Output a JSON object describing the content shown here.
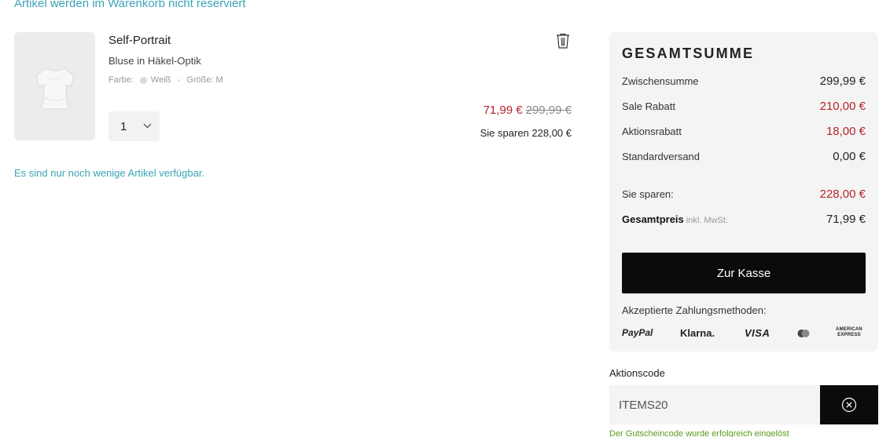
{
  "notice_top": "Artikel werden im Warenkorb nicht reserviert",
  "product": {
    "brand": "Self-Portrait",
    "name": "Bluse in Häkel-Optik",
    "color_label": "Farbe:",
    "color_value": "Weiß",
    "size_label": "Größe: M",
    "quantity": "1",
    "price_now": "71,99 €",
    "price_old": "299,99 €",
    "savings": "Sie sparen 228,00 €",
    "icons": {
      "delete": "trash-icon",
      "quantity": "chevron-down-icon"
    }
  },
  "low_stock": "Es sind nur noch wenige Artikel verfügbar.",
  "summary": {
    "title": "GESAMTSUMME",
    "rows": [
      {
        "label": "Zwischensumme",
        "value": "299,99 €"
      },
      {
        "label": "Sale Rabatt",
        "value": "210,00 €"
      },
      {
        "label": "Aktionsrabatt",
        "value": "18,00 €"
      },
      {
        "label": "Standardversand",
        "value": "0,00 €"
      }
    ],
    "you_save_label": "Sie sparen:",
    "you_save_value": "228,00 €",
    "total_label": "Gesamtpreis",
    "total_note": "inkl. MwSt.",
    "total_value": "71,99 €",
    "checkout_label": "Zur Kasse",
    "payment_label": "Akzeptierte Zahlungsmethoden:",
    "payment_methods": [
      "PayPal",
      "Klarna.",
      "VISA",
      "AMERICAN EXPRESS"
    ]
  },
  "promo": {
    "label": "Aktionscode",
    "value": "ITEMS20",
    "success": "Der Gutscheincode wurde erfolgreich eingelöst"
  },
  "colors": {
    "accent_teal": "#3ba3b5",
    "sale_red": "#b8232b",
    "success_green": "#5a9a1e",
    "button_black": "#0b0b0b",
    "panel_gray": "#f4f4f4"
  }
}
